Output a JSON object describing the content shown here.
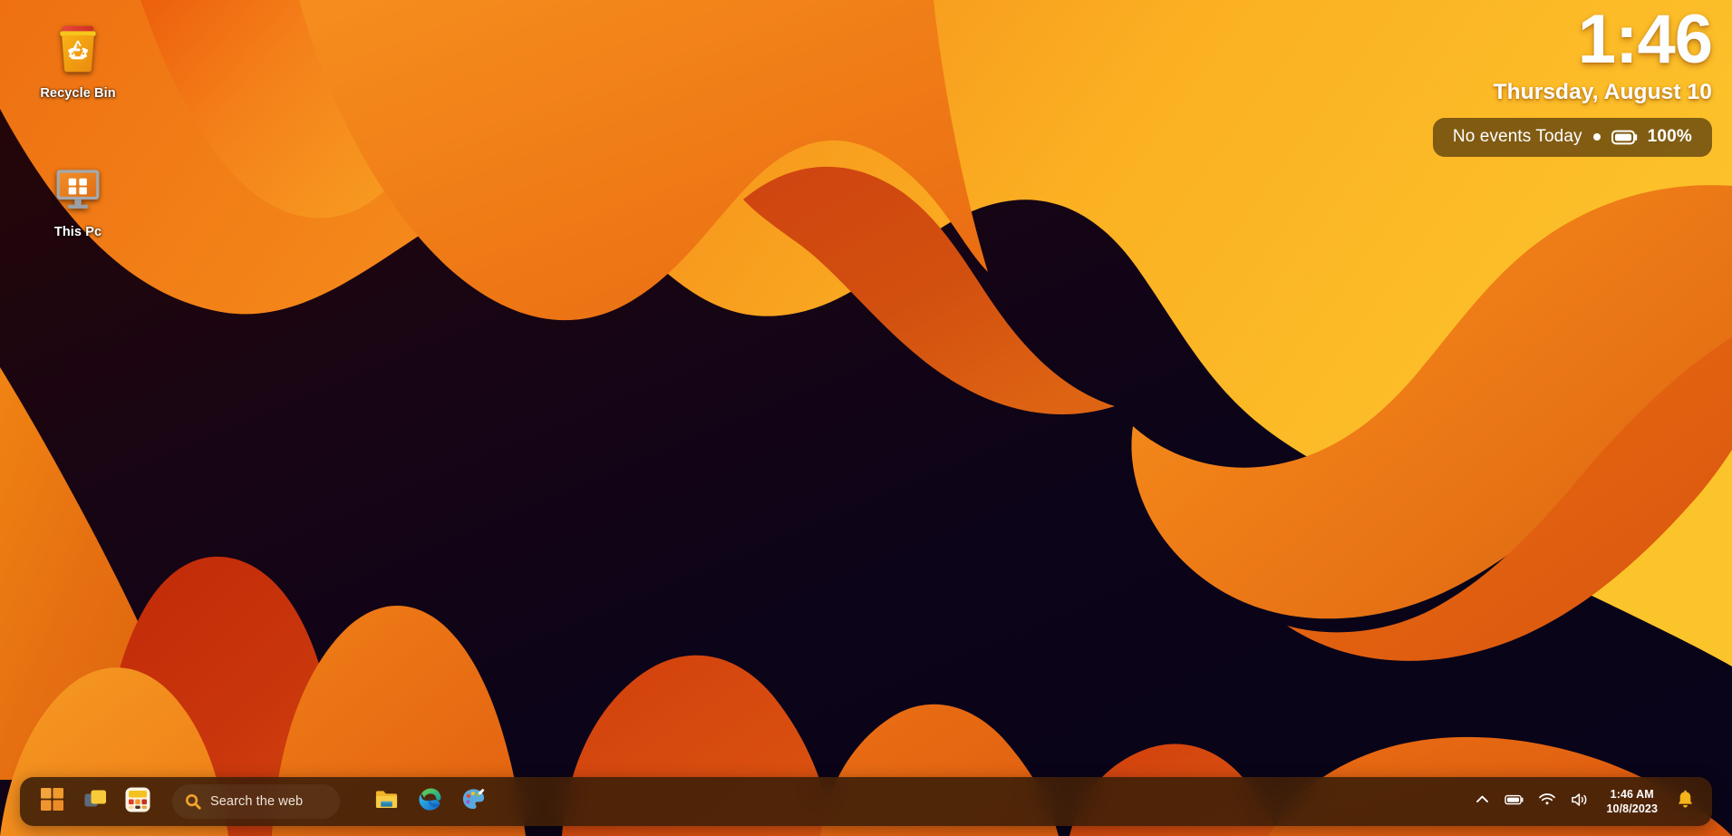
{
  "wallpaper": {
    "name": "orange-waves-dark-abstract",
    "colors": {
      "sky_top_left": "#ef7713",
      "sky_top_right": "#fbc02a",
      "orange_bright": "#f59222",
      "orange_mid": "#e8791a",
      "orange_deep": "#d4570f",
      "red_deep": "#c0300f",
      "red_dark": "#a82608",
      "center_dark": "#1b0509",
      "center_navy": "#0b0418"
    }
  },
  "desktop_icons": [
    {
      "id": "recycle-bin",
      "label": "Recycle Bin",
      "icon": "recycle-bin-icon"
    },
    {
      "id": "this-pc",
      "label": "This Pc",
      "icon": "this-pc-icon"
    }
  ],
  "clock_widget": {
    "time": "1:46",
    "date": "Thursday, August 10",
    "events_text": "No events Today",
    "separator_icon": "dot-separator-icon",
    "battery_icon": "battery-full-icon",
    "battery_percent": "100%"
  },
  "taskbar": {
    "buttons": [
      {
        "id": "start",
        "name": "start-button",
        "tooltip": "Start",
        "icon": "windows-logo-icon"
      },
      {
        "id": "task-view",
        "name": "task-view-button",
        "tooltip": "Task View",
        "icon": "task-view-icon"
      },
      {
        "id": "widgets",
        "name": "widgets-button",
        "tooltip": "Widgets",
        "icon": "widgets-icon"
      }
    ],
    "search": {
      "placeholder": "Search the web",
      "icon": "search-icon"
    },
    "pinned_apps": [
      {
        "id": "file-explorer",
        "name": "file-explorer-button",
        "tooltip": "File Explorer",
        "icon": "folder-icon"
      },
      {
        "id": "edge",
        "name": "edge-button",
        "tooltip": "Microsoft Edge",
        "icon": "edge-icon"
      },
      {
        "id": "paint",
        "name": "paint-button",
        "tooltip": "Paint",
        "icon": "paint-palette-icon"
      }
    ],
    "tray": {
      "icons": [
        {
          "id": "hidden-icons",
          "name": "show-hidden-icons-button",
          "tooltip": "Show hidden icons",
          "icon": "chevron-up-icon"
        },
        {
          "id": "battery",
          "name": "battery-tray-button",
          "tooltip": "Battery",
          "icon": "battery-full-icon"
        },
        {
          "id": "network",
          "name": "network-tray-button",
          "tooltip": "Network",
          "icon": "wifi-icon"
        },
        {
          "id": "volume",
          "name": "volume-tray-button",
          "tooltip": "Volume",
          "icon": "speaker-icon"
        }
      ],
      "clock": {
        "time": "1:46 AM",
        "date": "10/8/2023"
      },
      "notifications": {
        "name": "notifications-button",
        "icon": "bell-icon",
        "color": "#f5b41a"
      }
    }
  }
}
